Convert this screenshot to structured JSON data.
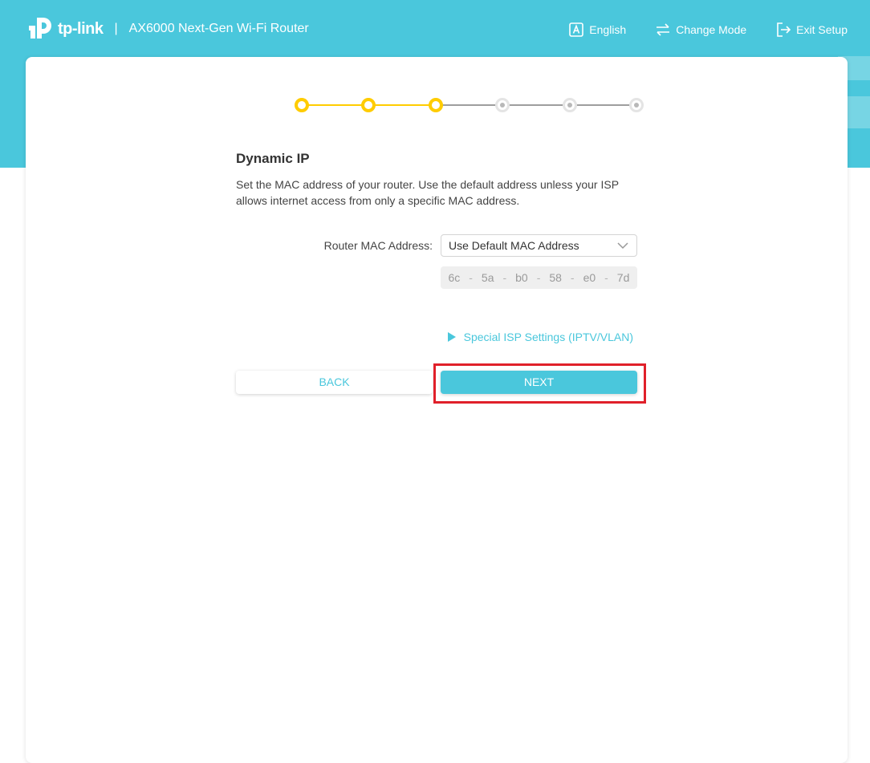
{
  "header": {
    "logo_text": "tp-link",
    "separator": "|",
    "product": "AX6000 Next-Gen Wi-Fi Router",
    "nav": {
      "language": "English",
      "change_mode": "Change Mode",
      "exit_setup": "Exit Setup"
    }
  },
  "stepper": {
    "total_steps": 6,
    "completed_steps": 3,
    "active_color": "#ffcc00",
    "inactive_color": "#9e9e9e"
  },
  "main": {
    "title": "Dynamic IP",
    "description": "Set the MAC address of your router. Use the default address unless your ISP allows internet access from only a specific MAC address.",
    "mac_field": {
      "label": "Router MAC Address:",
      "selected": "Use Default MAC Address",
      "octets": [
        "6c",
        "5a",
        "b0",
        "58",
        "e0",
        "7d"
      ],
      "separator": "-"
    },
    "isp_link": "Special ISP Settings (IPTV/VLAN)",
    "back_label": "BACK",
    "next_label": "NEXT"
  },
  "colors": {
    "brand": "#4ac7dc",
    "highlight": "#e0202a"
  }
}
